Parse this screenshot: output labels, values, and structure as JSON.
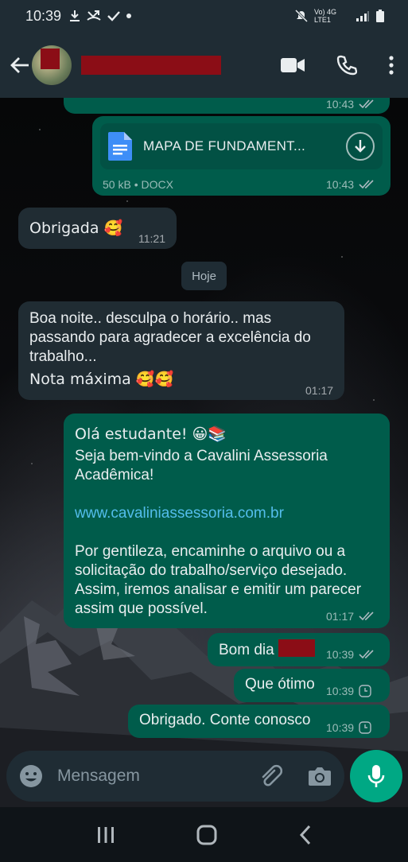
{
  "status_bar": {
    "time": "10:39",
    "network_label": "Vo) 4G LTE1"
  },
  "header": {
    "contact_name": "",
    "icons": [
      "back-arrow-icon",
      "video-call-icon",
      "phone-icon",
      "more-vert-icon"
    ]
  },
  "chat": {
    "top_partial_time": "10:43",
    "document": {
      "name": "MAPA DE FUNDAMENT...",
      "size_type": "50 kB • DOCX",
      "time": "10:43"
    },
    "incoming_1": {
      "text": "Obrigada 🥰",
      "time": "11:21"
    },
    "date_chip": "Hoje",
    "incoming_2": {
      "line1": "Boa noite.. desculpa o horário.. mas",
      "line2": "passando para agradecer a excelência do",
      "line3": "trabalho...",
      "line4": "Nota máxima 🥰🥰",
      "time": "01:17"
    },
    "outgoing_welcome": {
      "line1": "Olá estudante! 😀📚",
      "line2": "Seja bem-vindo a Cavalini Assessoria",
      "line3": "Acadêmica!",
      "link": "www.cavaliniassessoria.com.br",
      "line5": "Por gentileza, encaminhe o arquivo ou a",
      "line6": "solicitação do trabalho/serviço desejado.",
      "line7": "Assim, iremos analisar e emitir um parecer",
      "line8": "assim que possível.",
      "time": "01:17"
    },
    "outgoing_bomdia": {
      "text": "Bom dia",
      "time": "10:39"
    },
    "outgoing_otimo": {
      "text": "Que ótimo",
      "time": "10:39"
    },
    "outgoing_obrigado": {
      "text": "Obrigado. Conte conosco",
      "time": "10:39"
    }
  },
  "input": {
    "placeholder": "Mensagem"
  },
  "colors": {
    "outgoing_bubble": "#005c4b",
    "incoming_bubble": "#202c33",
    "accent": "#00a884",
    "link": "#53bdeb"
  }
}
